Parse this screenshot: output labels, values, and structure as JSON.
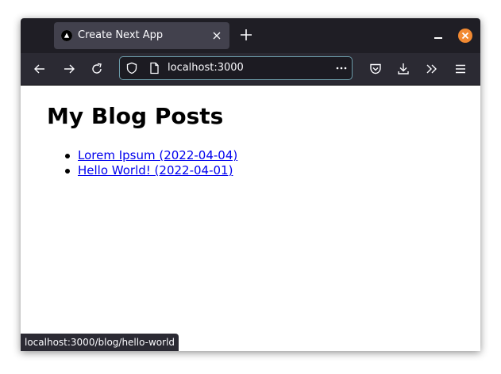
{
  "browser": {
    "tab": {
      "title": "Create Next App"
    },
    "address_bar": {
      "url": "localhost:3000"
    },
    "status_bar": {
      "text": "localhost:3000/blog/hello-world"
    },
    "colors": {
      "accent": "#f28a32",
      "link": "#0000ee",
      "chrome": "#2b2a33",
      "titlebar": "#1f1e25"
    }
  },
  "page": {
    "title": "My Blog Posts",
    "posts": [
      {
        "label": "Lorem Ipsum (2022-04-04)"
      },
      {
        "label": "Hello World! (2022-04-01)"
      }
    ]
  }
}
